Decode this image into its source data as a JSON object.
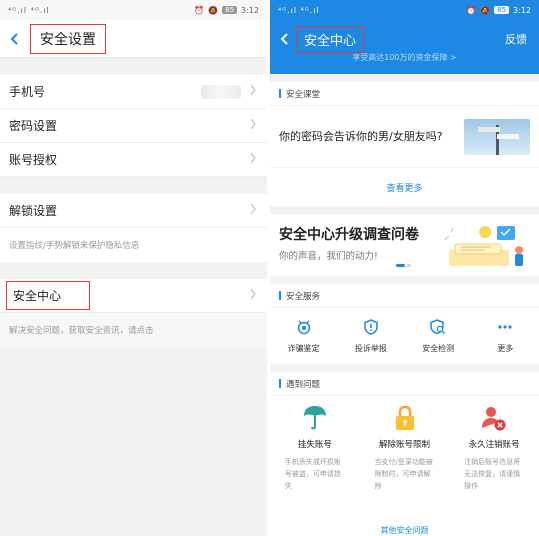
{
  "left": {
    "status": {
      "signal": "⁴ᴳ.ıl ⁴ᴳ.ıl",
      "battery": "85",
      "time": "3:12"
    },
    "title": "安全设置",
    "rows": {
      "phone": "手机号",
      "password": "密码设置",
      "auth": "账号授权",
      "unlock": "解锁设置",
      "unlock_hint": "设置指纹/手势解锁来保护隐私信息",
      "center": "安全中心",
      "center_hint": "解决安全问题，获取安全资讯，请点击"
    }
  },
  "right": {
    "status": {
      "signal": "⁴ᴳ.ıl ⁴ᴳ.ıl",
      "battery": "85",
      "time": "3:12"
    },
    "title": "安全中心",
    "feedback": "反馈",
    "subtitle": "享受高达100万的资金保障 >",
    "lesson": {
      "header": "安全课堂",
      "text": "你的密码会告诉你的男/女朋友吗?",
      "more": "查看更多"
    },
    "banner": {
      "title": "安全中心升级调查问卷",
      "subtitle": "你的声音，我们的动力!"
    },
    "services": {
      "header": "安全服务",
      "items": [
        {
          "label": "诈骗鉴定",
          "icon": "fraud-detect-icon"
        },
        {
          "label": "投诉举报",
          "icon": "report-shield-icon"
        },
        {
          "label": "安全检测",
          "icon": "security-scan-icon"
        },
        {
          "label": "更多",
          "icon": "more-dots-icon"
        }
      ]
    },
    "problems": {
      "header": "遇到问题",
      "items": [
        {
          "title": "挂失账号",
          "desc": "手机丢失或坏损账号被盗，可申请挂失"
        },
        {
          "title": "解除账号限制",
          "desc": "当支付/登录功能被限制时，可申请解除"
        },
        {
          "title": "永久注销账号",
          "desc": "注销后账号信息将无法恢复，请谨慎操作"
        }
      ],
      "more": "其他安全问题"
    }
  },
  "colors": {
    "accent": "#1e88e5",
    "highlight": "#e53935",
    "bg": "#f2f2f2"
  }
}
